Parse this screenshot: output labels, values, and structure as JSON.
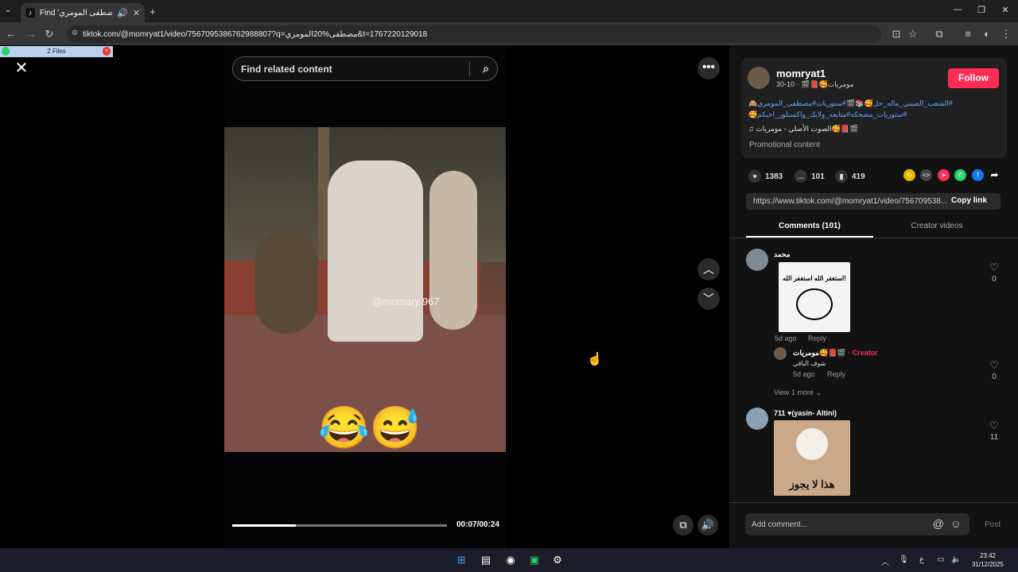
{
  "browser": {
    "tab_title": "Find 'مصطفى المومري' on T",
    "tab_icon": "tiktok-icon",
    "url": "tiktok.com/@momryat1/video/7567095386762988807?q=مصطفى%20المومري&t=1767220129018"
  },
  "files_bar": {
    "label": "2 Files"
  },
  "video": {
    "search_placeholder": "Find related content",
    "watermark": "@momary.967",
    "emoji": "😂😅",
    "time": "00:07/00:24",
    "progress_fraction": 0.296
  },
  "author": {
    "username": "momryat1",
    "subtitle": "مومريات🥰📕🎬 · 10-30",
    "follow_label": "Follow"
  },
  "description": "#الشعب_الصيني_ماله_حل🥰📚🎬#ستوريات#مصطفى_المومري🙈 #ستوريات_مضحكه#متابعه_ولايك_واكسبلور_احبكم🥰",
  "music": "♫ الصوت الأصلي - مومريات🥰📕🎬",
  "promo": "Promotional content",
  "stats": {
    "likes": "1383",
    "comments": "101",
    "saves": "419"
  },
  "share": {
    "link": "https://www.tiktok.com/@momryat1/video/756709538...",
    "copy_label": "Copy link"
  },
  "tabs": {
    "comments": "Comments (101)",
    "creator": "Creator videos"
  },
  "comments": [
    {
      "name": "محمد",
      "time": "5d ago",
      "reply": "Reply",
      "likes": "0",
      "sticker_text": "استغفر الله استغفر الله!"
    },
    {
      "name": "مومريات🥰📕🎬",
      "creator_badge": "· Creator",
      "text": "شوف الباقي",
      "time": "5d ago",
      "reply": "Reply",
      "likes": "0"
    },
    {
      "view_more": "View 1 more"
    },
    {
      "name": "711 ♥(yasin- Altini)",
      "likes": "11",
      "sticker_text": "هذا لا يجوز"
    }
  ],
  "add_comment": {
    "placeholder": "Add comment...",
    "post_label": "Post"
  },
  "taskbar": {
    "time": "23:42",
    "date": "31/12/2025",
    "lang": "ع"
  }
}
